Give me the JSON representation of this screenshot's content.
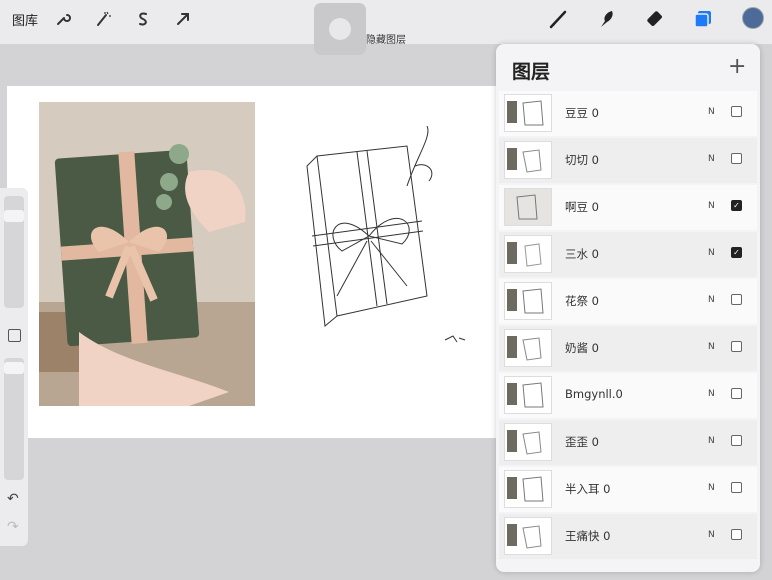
{
  "toolbar": {
    "gallery_label": "图库",
    "left_tools": [
      "wrench-icon",
      "magic-wand-icon",
      "selection-icon",
      "transform-arrow-icon"
    ],
    "hide_layer_label": "隐藏图层",
    "right_tools": [
      "brush-icon",
      "smudge-icon",
      "eraser-icon",
      "layers-icon"
    ],
    "active_color": "#4e6a98",
    "accent_color": "#1e7af5"
  },
  "layers_panel": {
    "title": "图层",
    "add_icon": "plus-icon",
    "layers": [
      {
        "name": "豆豆 0",
        "blend": "N",
        "visible": false
      },
      {
        "name": "切切 0",
        "blend": "N",
        "visible": false
      },
      {
        "name": "啊豆 0",
        "blend": "N",
        "visible": true
      },
      {
        "name": "三水 0",
        "blend": "N",
        "visible": true
      },
      {
        "name": "花祭 0",
        "blend": "N",
        "visible": false
      },
      {
        "name": "奶酱 0",
        "blend": "N",
        "visible": false
      },
      {
        "name": "Bmgynll.0",
        "blend": "N",
        "visible": false
      },
      {
        "name": "歪歪 0",
        "blend": "N",
        "visible": false
      },
      {
        "name": "半入耳 0",
        "blend": "N",
        "visible": false
      },
      {
        "name": "王痛快 0",
        "blend": "N",
        "visible": false
      }
    ]
  },
  "sidebar": {
    "undo_icon": "undo-icon",
    "redo_icon": "redo-icon"
  }
}
